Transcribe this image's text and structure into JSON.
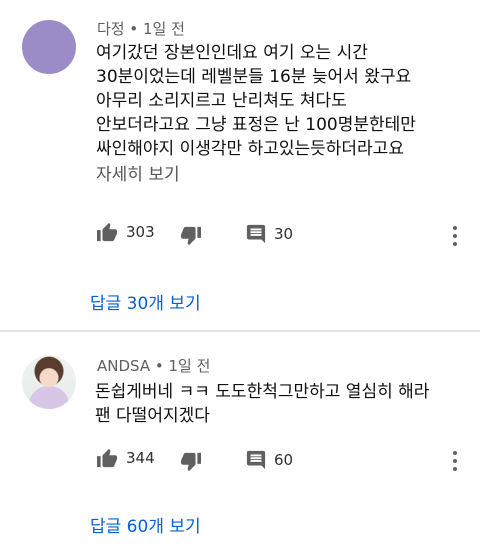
{
  "comments": [
    {
      "author": "다정",
      "time": "1일 전",
      "lines": [
        "여기갔던 장본인인데요 여기 오는 시간",
        "30분이었는데 레벨분들 16분 늦어서 왔구요",
        "아무리 소리지르고 난리쳐도 쳐다도",
        "안보더라고요 그냥 표정은 난 100명분한테만",
        "싸인해야지 이생각만 하고있는듯하더라고요"
      ],
      "read_more": "자세히 보기",
      "likes": "303",
      "replies_count": "30",
      "view_replies": "답글 30개 보기"
    },
    {
      "author": "ANDSA",
      "time": "1일 전",
      "lines": [
        "돈쉽게버네 ㅋㅋ 도도한척그만하고 열심히 해라",
        "팬 다떨어지겠다"
      ],
      "likes": "344",
      "replies_count": "60",
      "view_replies": "답글 60개 보기"
    }
  ],
  "separator": " • ",
  "icons": {
    "like": "thumbs-up-icon",
    "dislike": "thumbs-down-icon",
    "reply": "comment-icon",
    "more": "more-vert-icon"
  },
  "colors": {
    "link": "#065fd4",
    "meta": "#606060",
    "avatar": "#9b8cc7"
  }
}
